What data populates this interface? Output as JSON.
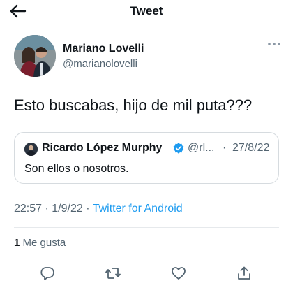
{
  "header": {
    "title": "Tweet"
  },
  "author": {
    "name": "Mariano Lovelli",
    "handle": "@marianolovelli"
  },
  "tweet": {
    "text": "Esto buscabas, hijo de mil puta???",
    "time": "22:57",
    "date": "1/9/22",
    "separator": "·",
    "source": "Twitter for Android"
  },
  "quote": {
    "name": "Ricardo López Murphy",
    "handle": "@rl...",
    "separator": "·",
    "date": "27/8/22",
    "text": "Son ellos o nosotros."
  },
  "engagement": {
    "likes_count": "1",
    "likes_label": "Me gusta"
  },
  "icons": {
    "back": "arrow-left-icon",
    "more": "more-horizontal-icon",
    "verified": "verified-badge-icon",
    "reply": "reply-icon",
    "retweet": "retweet-icon",
    "like": "heart-icon",
    "share": "share-icon"
  },
  "colors": {
    "link": "#1d9bf0",
    "secondary": "#536471",
    "primary": "#0f1419"
  }
}
